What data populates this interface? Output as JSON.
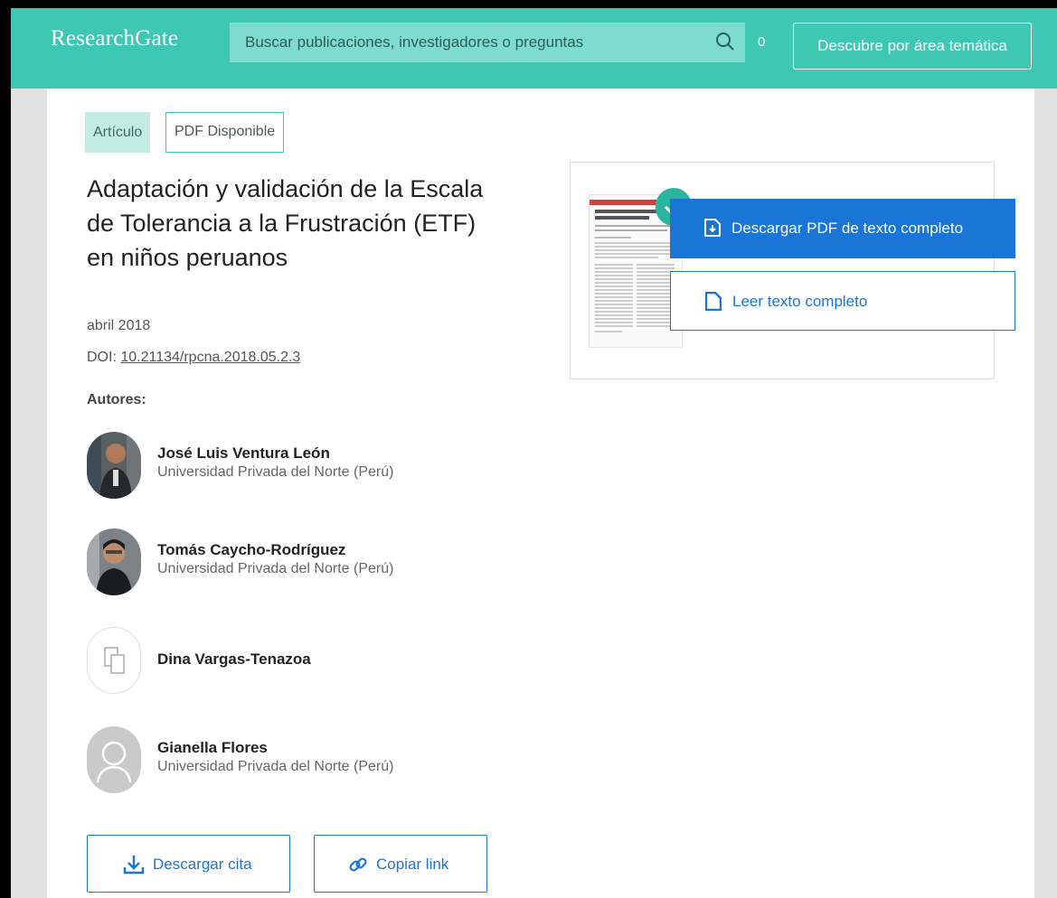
{
  "header": {
    "logo": "ResearchGate",
    "search_placeholder": "Buscar publicaciones, investigadores o preguntas",
    "notification_count": "0",
    "topic_button": "Descubre por área temática"
  },
  "article": {
    "tags": [
      "Artículo",
      "PDF Disponible"
    ],
    "title_lines": [
      "Adaptación y validación de la Escala",
      "de Tolerancia a la Frustración (ETF)",
      "en niños peruanos"
    ],
    "date": "abril 2018",
    "doi_label": "DOI:",
    "doi": "10.21134/rpcna.2018.05.2.3",
    "authors_heading": "Autores:"
  },
  "authors": [
    {
      "name": "José Luis Ventura León",
      "affiliation": "Universidad Privada del Norte (Perú)",
      "avatar": "photo"
    },
    {
      "name": "Tomás Caycho-Rodríguez",
      "affiliation": "Universidad Privada del Norte (Perú)",
      "avatar": "photo"
    },
    {
      "name": "Dina Vargas-Tenazoa",
      "affiliation": "",
      "avatar": "placeholder-pages"
    },
    {
      "name": "Gianella Flores",
      "affiliation": "Universidad Privada del Norte (Perú)",
      "avatar": "placeholder-person"
    }
  ],
  "actions": {
    "download_citation": "Descargar cita",
    "copy_link": "Copiar link"
  },
  "pdf_card": {
    "download_pdf": "Descargar PDF de texto completo",
    "read_full_text": "Leer texto completo"
  },
  "colors": {
    "brand": "#3ec8b4",
    "primary_button": "#1a75d6"
  }
}
